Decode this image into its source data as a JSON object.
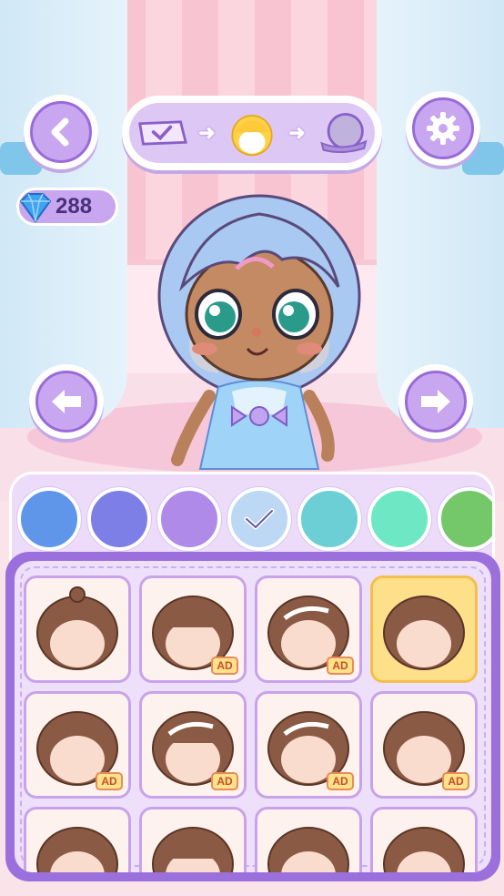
{
  "header": {
    "back_icon": "chevron-left-icon",
    "settings_icon": "gear-icon",
    "steps": [
      {
        "name": "outfit-step",
        "icon": "dress-check-icon",
        "active": false
      },
      {
        "name": "hair-step",
        "icon": "hair-icon",
        "active": true
      },
      {
        "name": "accessory-step",
        "icon": "hat-icon",
        "active": false
      }
    ]
  },
  "currency": {
    "gems": "288",
    "icon": "diamond-icon"
  },
  "navigation": {
    "prev_icon": "arrow-left-icon",
    "next_icon": "arrow-right-icon"
  },
  "palette": {
    "colors": [
      "#5f96e9",
      "#7d7fe6",
      "#b08ae8",
      "#bcd8f5",
      "#6ccfd6",
      "#6ee8c4",
      "#74c86a"
    ],
    "selected_index": 3
  },
  "hair_options": {
    "ad_label": "AD",
    "items": [
      {
        "style": 1,
        "ad": false,
        "selected": false
      },
      {
        "style": 2,
        "ad": true,
        "selected": false
      },
      {
        "style": 3,
        "ad": true,
        "selected": false
      },
      {
        "style": 4,
        "ad": false,
        "selected": true
      },
      {
        "style": 5,
        "ad": true,
        "selected": false
      },
      {
        "style": 6,
        "ad": true,
        "selected": false
      },
      {
        "style": 7,
        "ad": true,
        "selected": false
      },
      {
        "style": 8,
        "ad": true,
        "selected": false
      },
      {
        "style": 9,
        "ad": false,
        "selected": false
      },
      {
        "style": 10,
        "ad": false,
        "selected": false
      },
      {
        "style": 11,
        "ad": false,
        "selected": false
      },
      {
        "style": 12,
        "ad": false,
        "selected": false
      }
    ]
  },
  "colors": {
    "accent": "#9b6fdc",
    "button": "#c9a6f0",
    "hair_brown": "#8a5a44",
    "skin": "#f9dccd"
  }
}
